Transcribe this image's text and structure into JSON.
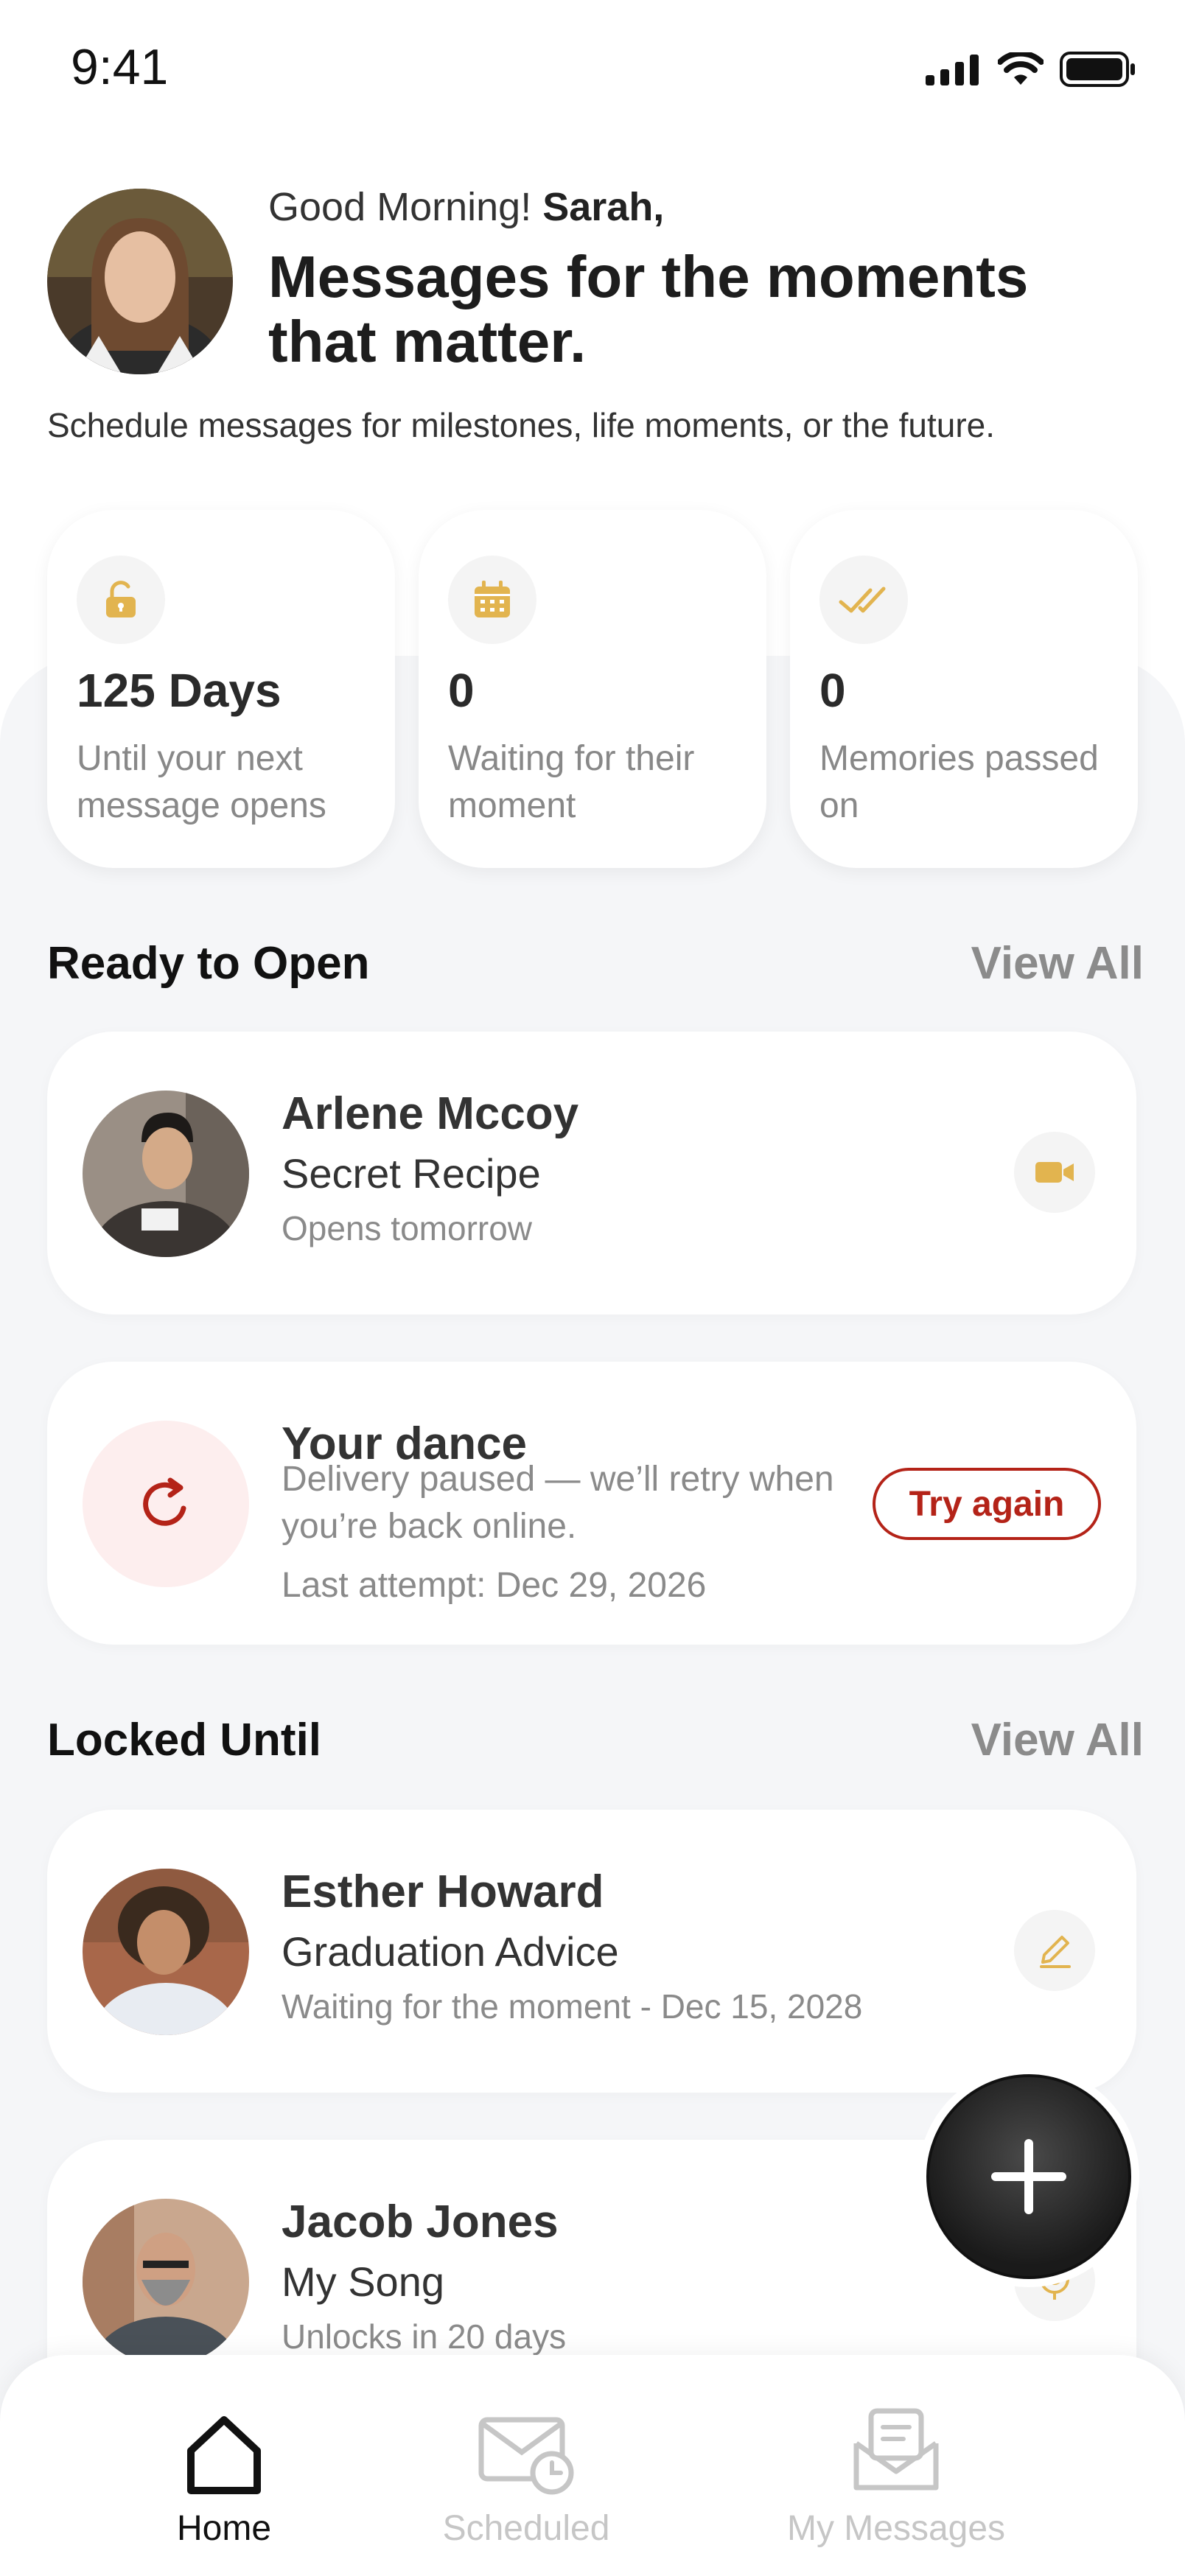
{
  "status": {
    "time": "9:41"
  },
  "header": {
    "greeting_prefix": "Good Morning!",
    "user_name": "Sarah,",
    "headline": "Messages for the moments that matter.",
    "subtitle": "Schedule messages for milestones, life moments, or the future."
  },
  "stats": [
    {
      "icon": "unlock-icon",
      "value": "125 Days",
      "label": "Until your next message opens"
    },
    {
      "icon": "calendar-icon",
      "value": "0",
      "label": "Waiting for their moment"
    },
    {
      "icon": "double-check-icon",
      "value": "0",
      "label": "Memories passed on"
    }
  ],
  "ready_section": {
    "title": "Ready to Open",
    "view_all": "View All"
  },
  "ready_items": [
    {
      "name": "Arlene Mccoy",
      "title": "Secret Recipe",
      "subtitle": "Opens tomorrow",
      "icon": "video-camera-icon"
    }
  ],
  "failed_item": {
    "title": "Your dance",
    "description": "Delivery paused — we’ll retry when you’re back online.",
    "last_attempt": "Last attempt: Dec 29, 2026",
    "action": "Try again",
    "icon": "retry-icon"
  },
  "locked_section": {
    "title": "Locked Until",
    "view_all": "View All"
  },
  "locked_items": [
    {
      "name": "Esther Howard",
      "title": "Graduation Advice",
      "subtitle": "Waiting for the moment - Dec 15, 2028",
      "icon": "pencil-icon"
    },
    {
      "name": "Jacob Jones",
      "title": "My Song",
      "subtitle": "Unlocks in 20 days",
      "icon": "microphone-icon"
    }
  ],
  "fab": {
    "icon": "plus-icon"
  },
  "nav": [
    {
      "label": "Home",
      "icon": "home-icon",
      "active": true
    },
    {
      "label": "Scheduled",
      "icon": "scheduled-mail-icon",
      "active": false
    },
    {
      "label": "My Messages",
      "icon": "messages-icon",
      "active": false
    }
  ],
  "colors": {
    "accent": "#e2b44f",
    "error": "#b42318",
    "background": "#f5f6f8"
  }
}
